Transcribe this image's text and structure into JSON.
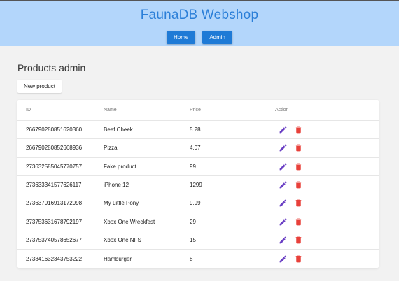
{
  "header": {
    "title": "FaunaDB Webshop",
    "nav": [
      {
        "label": "Home"
      },
      {
        "label": "Admin"
      }
    ]
  },
  "page": {
    "title": "Products admin",
    "new_button": "New product"
  },
  "table": {
    "columns": {
      "id": "ID",
      "name": "Name",
      "price": "Price",
      "action": "Action"
    },
    "rows": [
      {
        "id": "266790280851620360",
        "name": "Beef Cheek",
        "price": "5.28"
      },
      {
        "id": "266790280852668936",
        "name": "Pizza",
        "price": "4.07"
      },
      {
        "id": "273632585045770757",
        "name": "Fake product",
        "price": "99"
      },
      {
        "id": "273633341577626117",
        "name": "iPhone 12",
        "price": "1299"
      },
      {
        "id": "273637916913172998",
        "name": "My Little Pony",
        "price": "9.99"
      },
      {
        "id": "273753631678792197",
        "name": "Xbox One Wreckfest",
        "price": "29"
      },
      {
        "id": "273753740578652677",
        "name": "Xbox One NFS",
        "price": "15"
      },
      {
        "id": "273841632343753222",
        "name": "Hamburger",
        "price": "8"
      }
    ]
  },
  "icons": {
    "edit": "pencil-icon",
    "delete": "trash-icon"
  },
  "colors": {
    "header_bg": "#b3d6fb",
    "title": "#2b7fd8",
    "nav_button": "#1e7ad6",
    "edit_icon": "#6a3fc4",
    "delete_icon": "#e8403a"
  }
}
